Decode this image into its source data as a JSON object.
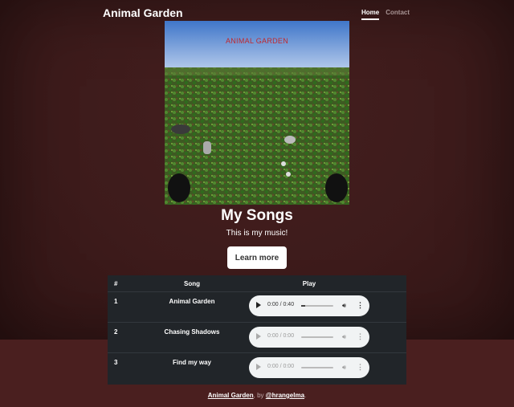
{
  "header": {
    "brand": "Animal Garden",
    "nav": [
      {
        "label": "Home",
        "active": true
      },
      {
        "label": "Contact",
        "active": false
      }
    ]
  },
  "cover": {
    "title": "ANIMAL GARDEN"
  },
  "hero": {
    "heading": "My Songs",
    "lead": "This is my music!",
    "button": "Learn more"
  },
  "table": {
    "headers": [
      "#",
      "Song",
      "Play"
    ],
    "rows": [
      {
        "num": "1",
        "song": "Animal Garden",
        "time": "0:00 / 0:40",
        "progress": 0.12,
        "enabled": true
      },
      {
        "num": "2",
        "song": "Chasing Shadows",
        "time": "0:00 / 0:00",
        "progress": 0,
        "enabled": false
      },
      {
        "num": "3",
        "song": "Find my way",
        "time": "0:00 / 0:00",
        "progress": 0,
        "enabled": false
      }
    ]
  },
  "footer": {
    "link1": "Animal Garden",
    "sep": ", by ",
    "link2": "@hrangelma",
    "end": "."
  },
  "icons": {
    "play": "play-icon",
    "volume": "volume-icon",
    "more": "more-options-icon"
  },
  "colors": {
    "background": "#3d1b1b",
    "table": "#212529",
    "cover_title": "#c0282e"
  }
}
